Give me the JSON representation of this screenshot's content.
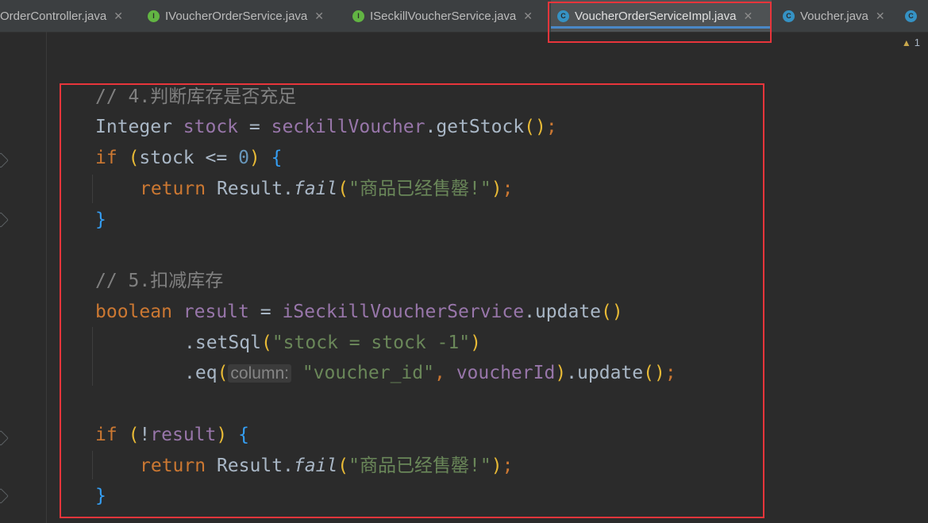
{
  "tabs": [
    {
      "label": "OrderController.java",
      "kind": "class",
      "icon": "C"
    },
    {
      "label": "IVoucherOrderService.java",
      "kind": "interface",
      "icon": "I"
    },
    {
      "label": "ISeckillVoucherService.java",
      "kind": "interface",
      "icon": "I"
    },
    {
      "label": "VoucherOrderServiceImpl.java",
      "kind": "class",
      "icon": "C",
      "active": true
    },
    {
      "label": "Voucher.java",
      "kind": "class",
      "icon": "C"
    }
  ],
  "warnings": {
    "count": "1"
  },
  "code": {
    "comment1": "// 4.判断库存是否充足",
    "type_integer": "Integer",
    "var_stock": "stock",
    "var_seckill": "seckillVoucher",
    "method_getStock": "getStock",
    "kw_if": "if",
    "num_zero": "0",
    "kw_return": "return",
    "cls_result": "Result",
    "method_fail": "fail",
    "str_soldout": "\"商品已经售罄!\"",
    "comment2": "// 5.扣减库存",
    "kw_boolean": "boolean",
    "var_result": "result",
    "var_service": "iSeckillVoucherService",
    "method_update": "update",
    "method_setSql": "setSql",
    "str_setsql": "\"stock = stock -1\"",
    "method_eq": "eq",
    "hint_column": "column:",
    "str_voucher_id": "\"voucher_id\"",
    "var_voucherId": "voucherId"
  },
  "colors": {
    "background": "#2b2b2b",
    "keyword": "#cc7832",
    "comment": "#808080",
    "field": "#9876aa",
    "method": "#ffc66d",
    "string": "#6a8759",
    "number": "#6897bb",
    "highlight_box": "#e8353b"
  }
}
